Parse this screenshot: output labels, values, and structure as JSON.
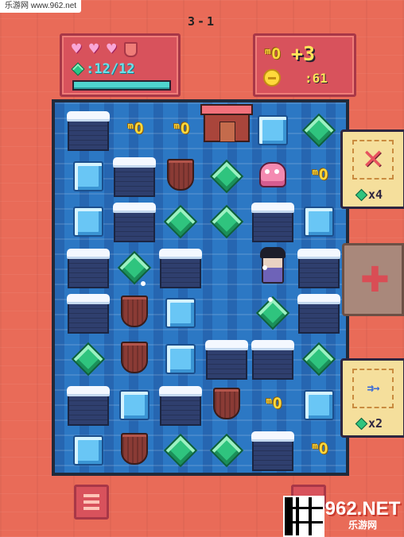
{
  "watermark": "乐游网 www.962.net",
  "level": "3-1",
  "hud": {
    "health": {
      "hearts_full": 3,
      "empty_slot_icon": "shield-outline-icon"
    },
    "gems": {
      "icon": "green-gem-icon",
      "text": ":12/12",
      "fill_fraction": 1.0
    },
    "keys": {
      "icon": "key-icon",
      "value": "+3"
    },
    "coins": {
      "icon": "coin-icon",
      "value": ":61"
    }
  },
  "board": {
    "columns": 6,
    "rows": 8,
    "tiles": [
      [
        "ice-block",
        "key",
        "key",
        "shrine",
        "ice-cube",
        "gem"
      ],
      [
        "ice-cube",
        "ice-block",
        "shield",
        "gem",
        "monster",
        "key"
      ],
      [
        "ice-cube",
        "ice-block",
        "gem",
        "gem",
        "ice-block",
        "ice-cube"
      ],
      [
        "ice-block",
        "gem",
        "ice-block",
        "empty",
        "hero",
        "ice-block"
      ],
      [
        "ice-block",
        "shield",
        "ice-cube",
        "empty",
        "gem",
        "ice-block"
      ],
      [
        "gem",
        "shield",
        "ice-cube",
        "ice-block",
        "ice-block",
        "gem"
      ],
      [
        "ice-block",
        "ice-cube",
        "ice-block",
        "shield",
        "key",
        "ice-cube"
      ],
      [
        "ice-cube",
        "shield",
        "gem",
        "gem",
        "ice-block",
        "key"
      ]
    ],
    "key_glyph": "ᵐO"
  },
  "cards": [
    {
      "icon": "crossed-arrows-icon",
      "cost_icon": "green-gem-icon",
      "cost": "x4",
      "locked": false
    },
    {
      "icon": "plus-icon",
      "locked": true
    },
    {
      "icon": "dash-arrows-icon",
      "arrows_text": "⇉→",
      "cost_icon": "green-gem-icon",
      "cost": "x2",
      "locked": false
    }
  ],
  "footer": {
    "menu_icon": "menu-list-icon",
    "sound_icon": "speaker-icon",
    "logo_main": "962.NET",
    "logo_sub": "乐游网"
  },
  "colors": {
    "background": "#e96b58",
    "panel": "#d8525c",
    "board_water": "#2c78c4",
    "accent_gold": "#ffd93b",
    "gem_green": "#2fc47e"
  }
}
